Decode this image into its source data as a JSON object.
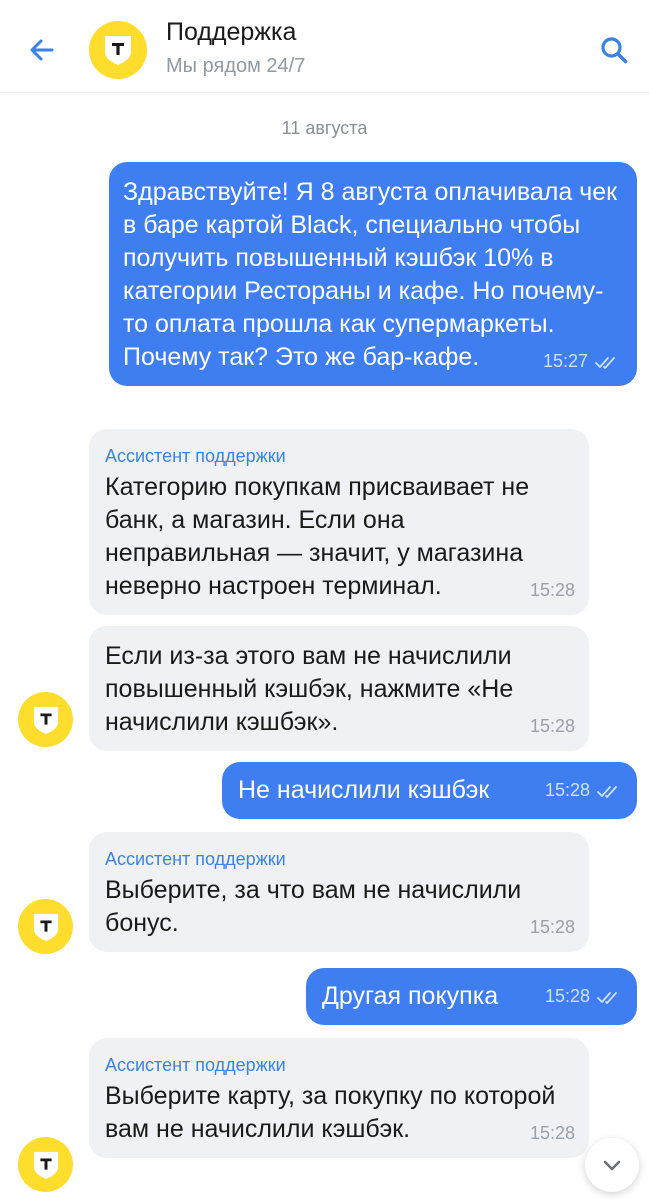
{
  "header": {
    "title": "Поддержка",
    "subtitle": "Мы рядом 24/7"
  },
  "date_separator": "11 августа",
  "messages": [
    {
      "direction": "outgoing",
      "text": "Здравствуйте! Я 8 августа оплачивала чек в баре картой Black, специально чтобы получить повышенный кэшбэк 10% в категории Рестораны и кафе. Но почему-то оплата прошла как супермаркеты. Почему так? Это же бар-кафе.",
      "time": "15:27",
      "read": true
    },
    {
      "direction": "incoming",
      "sender": "Ассистент поддержки",
      "text": "Категорию покупкам присваивает не банк, а магазин. Если она неправильная — значит, у магазина неверно настроен терминал.",
      "time": "15:28"
    },
    {
      "direction": "incoming",
      "text": "Если из-за этого вам не начислили повышенный кэшбэк, нажмите «Не начислили кэшбэк».",
      "time": "15:28"
    },
    {
      "direction": "outgoing",
      "text": "Не начислили кэшбэк",
      "time": "15:28",
      "read": true
    },
    {
      "direction": "incoming",
      "sender": "Ассистент поддержки",
      "text": "Выберите, за что вам не начислили бонус.",
      "time": "15:28"
    },
    {
      "direction": "outgoing",
      "text": "Другая покупка",
      "time": "15:28",
      "read": true
    },
    {
      "direction": "incoming",
      "sender": "Ассистент поддержки",
      "text": "Выберите карту, за покупку по которой вам не начислили кэшбэк.",
      "time": "15:28"
    }
  ],
  "colors": {
    "accent": "#3e7ef0",
    "brand_yellow": "#ffdd2d",
    "incoming_bg": "#eff1f4",
    "sender_blue": "#3a83e4"
  },
  "icons": {
    "back": "arrow-left-icon",
    "search": "search-icon",
    "avatar": "bank-logo-icon",
    "read": "double-check-icon",
    "scroll": "chevron-down-icon"
  }
}
